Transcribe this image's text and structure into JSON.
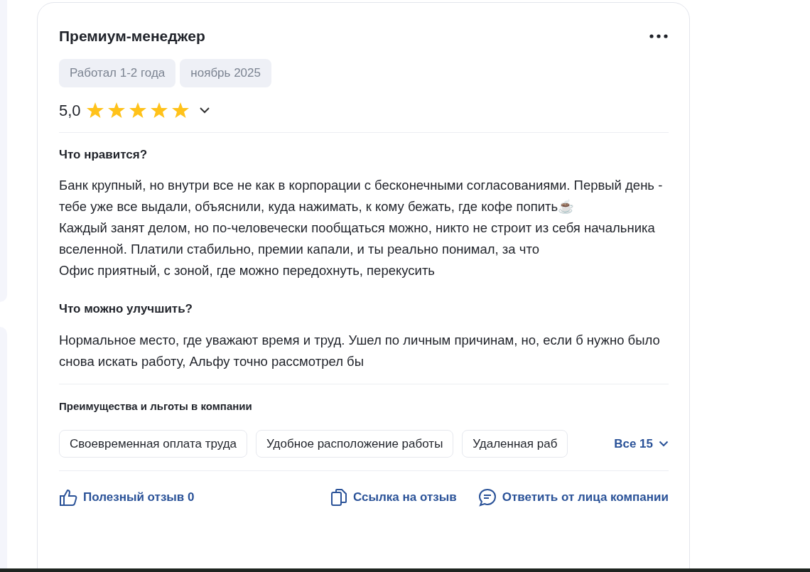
{
  "review": {
    "title": "Премиум-менеджер",
    "tags": [
      "Работал 1-2 года",
      "ноябрь 2025"
    ],
    "rating": "5,0",
    "stars": 5,
    "sections": [
      {
        "heading": "Что нравится?",
        "paragraphs": [
          "Банк крупный, но внутри все не как в корпорации с бесконечными согласованиями. Первый день - тебе уже все выдали, объяснили, куда нажимать, к кому бежать, где кофе попить☕",
          "Каждый занят делом, но по-человечески пообщаться можно, никто не строит из себя начальника вселенной. Платили стабильно, премии капали, и ты реально понимал, за что",
          "Офис приятный, с зоной, где можно передохнуть, перекусить"
        ]
      },
      {
        "heading": "Что можно улучшить?",
        "paragraphs": [
          "Нормальное место, где уважают время и труд. Ушел по личным причинам, но, если б нужно было снова искать работу, Альфу точно рассмотрел бы"
        ]
      }
    ],
    "benefits": {
      "heading": "Преимущества и льготы в компании",
      "items": [
        "Своевременная оплата труда",
        "Удобное расположение работы",
        "Удаленная раб"
      ],
      "more": "Все 15"
    },
    "actions": {
      "helpful": "Полезный отзыв 0",
      "link": "Ссылка на отзыв",
      "reply": "Ответить от лица компании"
    }
  }
}
